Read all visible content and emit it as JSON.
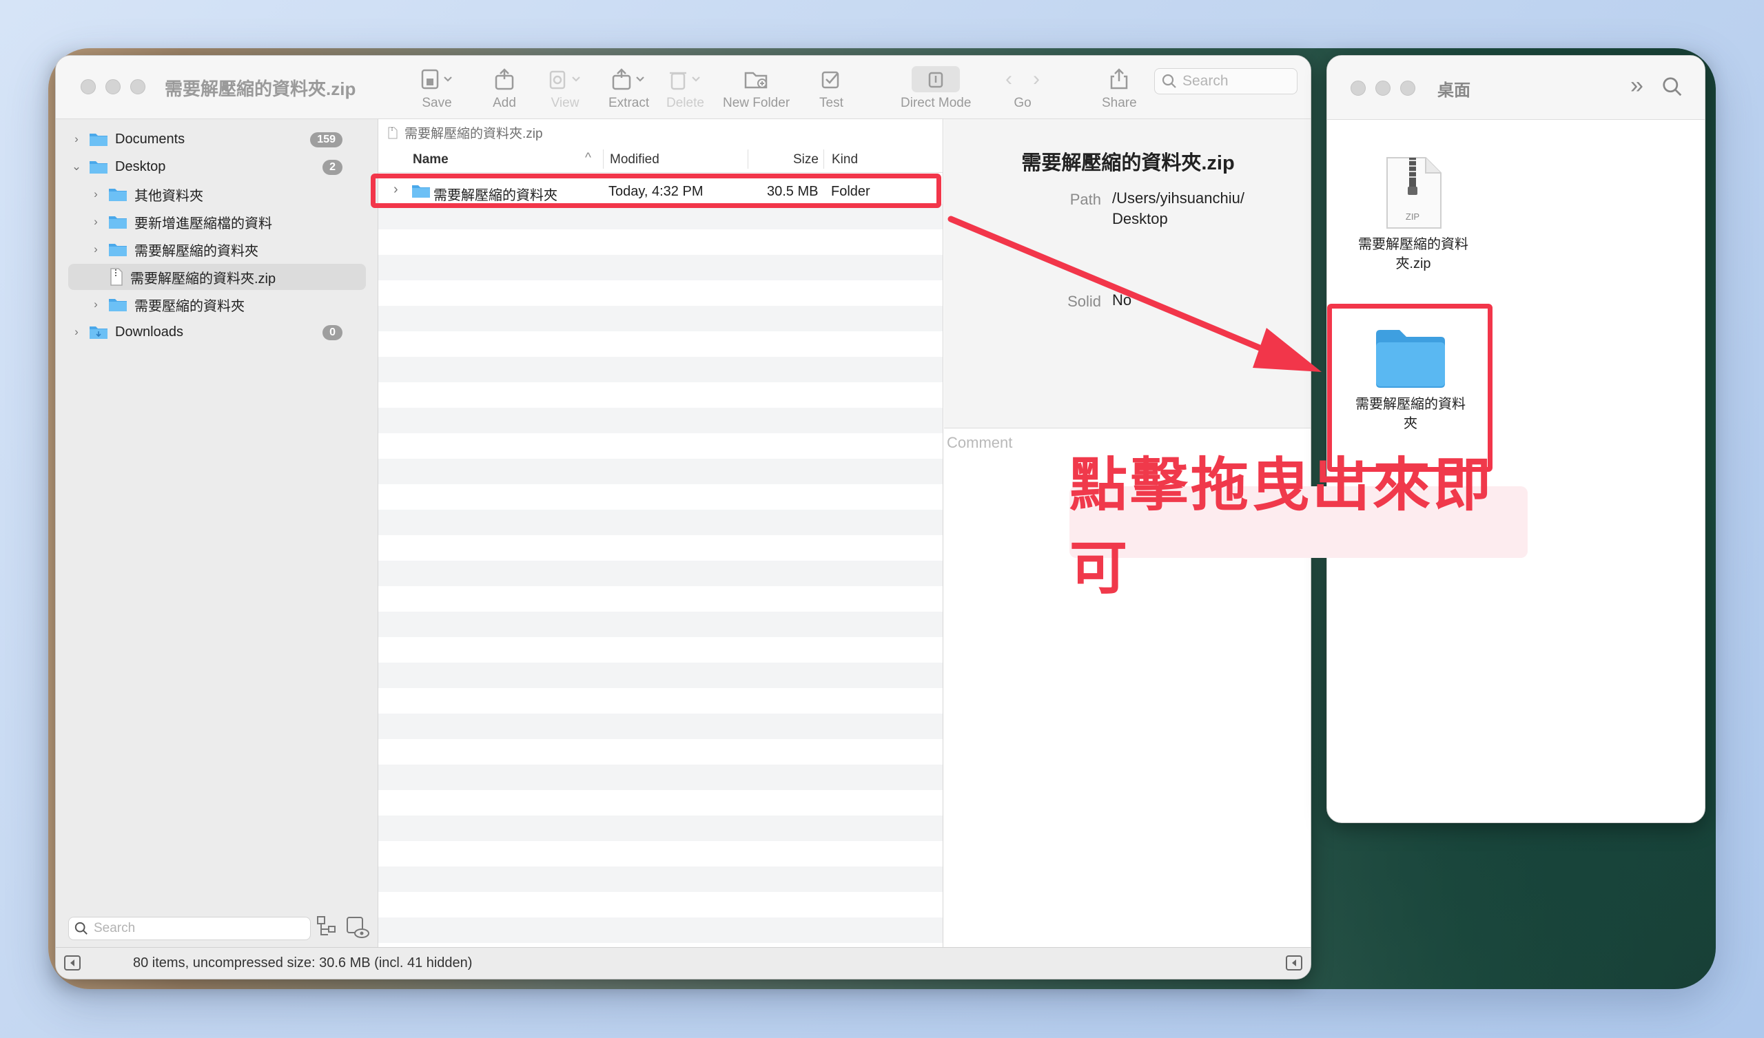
{
  "main_window": {
    "title": "需要解壓縮的資料夾.zip",
    "toolbar": {
      "save": "Save",
      "add": "Add",
      "view": "View",
      "extract": "Extract",
      "delete": "Delete",
      "new_folder": "New Folder",
      "test": "Test",
      "direct_mode": "Direct Mode",
      "go": "Go",
      "share": "Share",
      "search_placeholder": "Search"
    },
    "sidebar": {
      "items": [
        {
          "label": "Documents",
          "badge": "159"
        },
        {
          "label": "Desktop",
          "badge": "2"
        },
        {
          "label": "其他資料夾"
        },
        {
          "label": "要新增進壓縮檔的資料"
        },
        {
          "label": "需要解壓縮的資料夾"
        },
        {
          "label": "需要解壓縮的資料夾.zip"
        },
        {
          "label": "需要壓縮的資料夾"
        },
        {
          "label": "Downloads",
          "badge": "0"
        }
      ],
      "search_placeholder": "Search"
    },
    "file_list": {
      "path": "需要解壓縮的資料夾.zip",
      "columns": {
        "name": "Name",
        "modified": "Modified",
        "size": "Size",
        "kind": "Kind"
      },
      "rows": [
        {
          "name": "需要解壓縮的資料夾",
          "modified": "Today, 4:32 PM",
          "size": "30.5 MB",
          "kind": "Folder"
        }
      ]
    },
    "info": {
      "title": "需要解壓縮的資料夾.zip",
      "path_label": "Path",
      "path_line1": "/Users/yihsuanchiu/",
      "path_line2": "Desktop",
      "solid_label": "Solid",
      "solid_value": "No",
      "comment_placeholder": "Comment"
    },
    "status": "80 items, uncompressed size: 30.6 MB (incl. 41 hidden)"
  },
  "desktop_window": {
    "title": "桌面",
    "items": [
      {
        "line1": "需要解壓縮的資料",
        "line2": "夾.zip",
        "icon_label": "ZIP"
      },
      {
        "line1": "需要解壓縮的資料",
        "line2": "夾"
      }
    ]
  },
  "annotation": {
    "callout": "點擊拖曳出來即可",
    "color": "#f2364a"
  }
}
